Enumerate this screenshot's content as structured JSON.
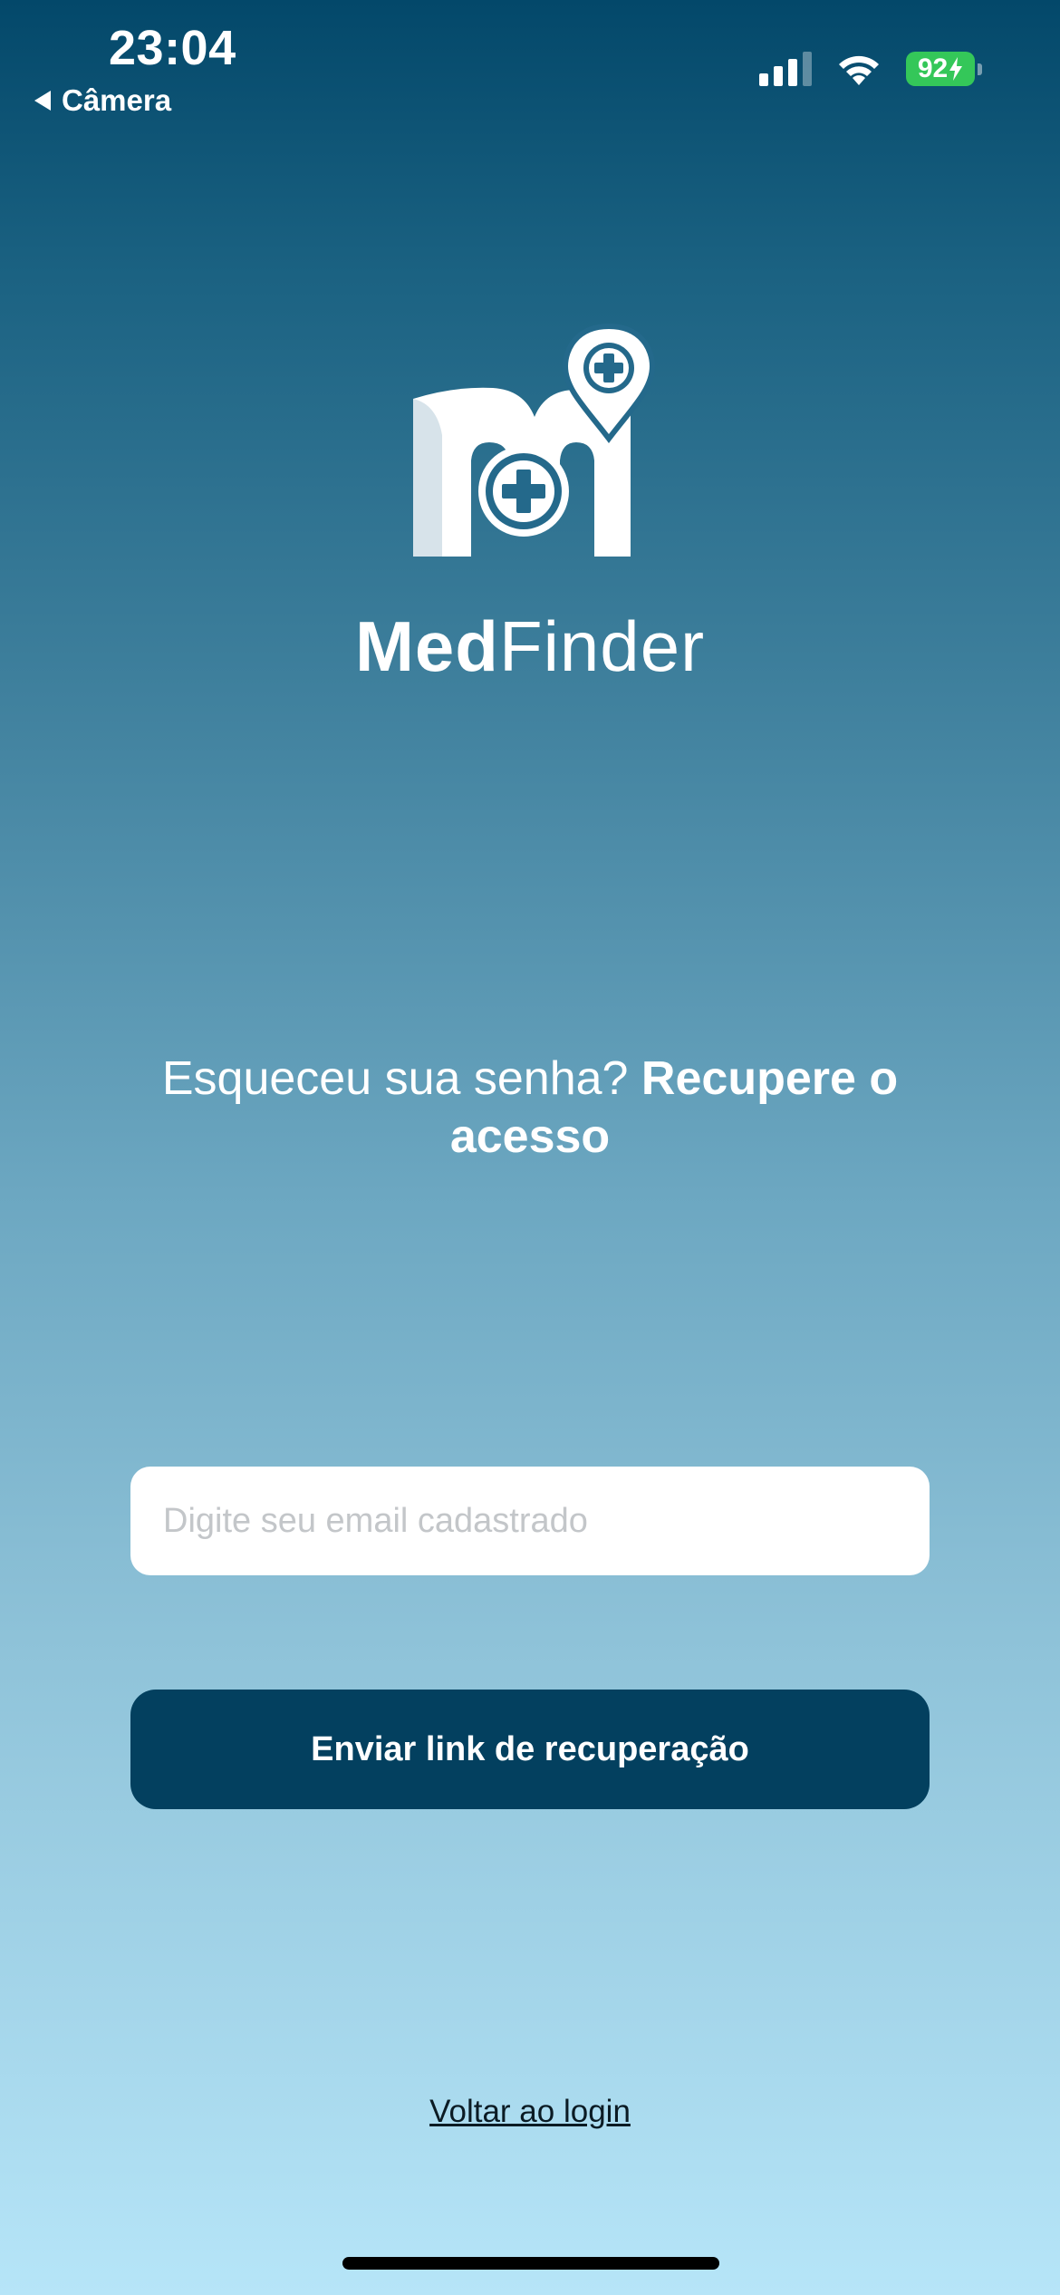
{
  "status_bar": {
    "time": "23:04",
    "back_app": "Câmera",
    "battery": "92",
    "battery_color": "#34c759"
  },
  "icons": {
    "back": "triangle-left-icon",
    "signal": "cellular-signal-icon",
    "wifi": "wifi-icon",
    "battery": "battery-charging-icon",
    "logo": "medfinder-logo-icon"
  },
  "brand": {
    "part1": "Med",
    "part2": "Finder"
  },
  "heading": {
    "regular": "Esqueceu sua senha?",
    "bold": "Recupere o acesso"
  },
  "email_input": {
    "value": "",
    "placeholder": "Digite seu email cadastrado"
  },
  "send_button": {
    "label": "Enviar link de recuperação"
  },
  "back_to_login": {
    "label": "Voltar ao login"
  },
  "colors": {
    "gradient_top": "#03486a",
    "gradient_bottom": "#b6e5f8",
    "button": "#03405f"
  }
}
